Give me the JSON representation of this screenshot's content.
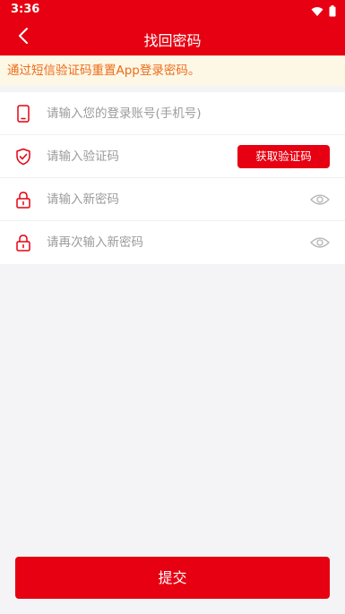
{
  "status": {
    "time": "3:36"
  },
  "nav": {
    "title": "找回密码"
  },
  "notice": {
    "text": "通过短信验证码重置App登录密码。"
  },
  "form": {
    "account": {
      "placeholder": "请输入您的登录账号(手机号)"
    },
    "code": {
      "placeholder": "请输入验证码",
      "button_label": "获取验证码"
    },
    "new_password": {
      "placeholder": "请输入新密码"
    },
    "confirm_password": {
      "placeholder": "请再次输入新密码"
    }
  },
  "submit": {
    "label": "提交"
  },
  "colors": {
    "accent": "#e60012",
    "notice_text": "#ec6c19",
    "notice_bg": "#fdf7e6"
  },
  "icons": {
    "back": "chevron-left-icon",
    "account": "phone-icon",
    "code": "shield-check-icon",
    "password": "lock-icon",
    "toggle": "eye-icon"
  }
}
